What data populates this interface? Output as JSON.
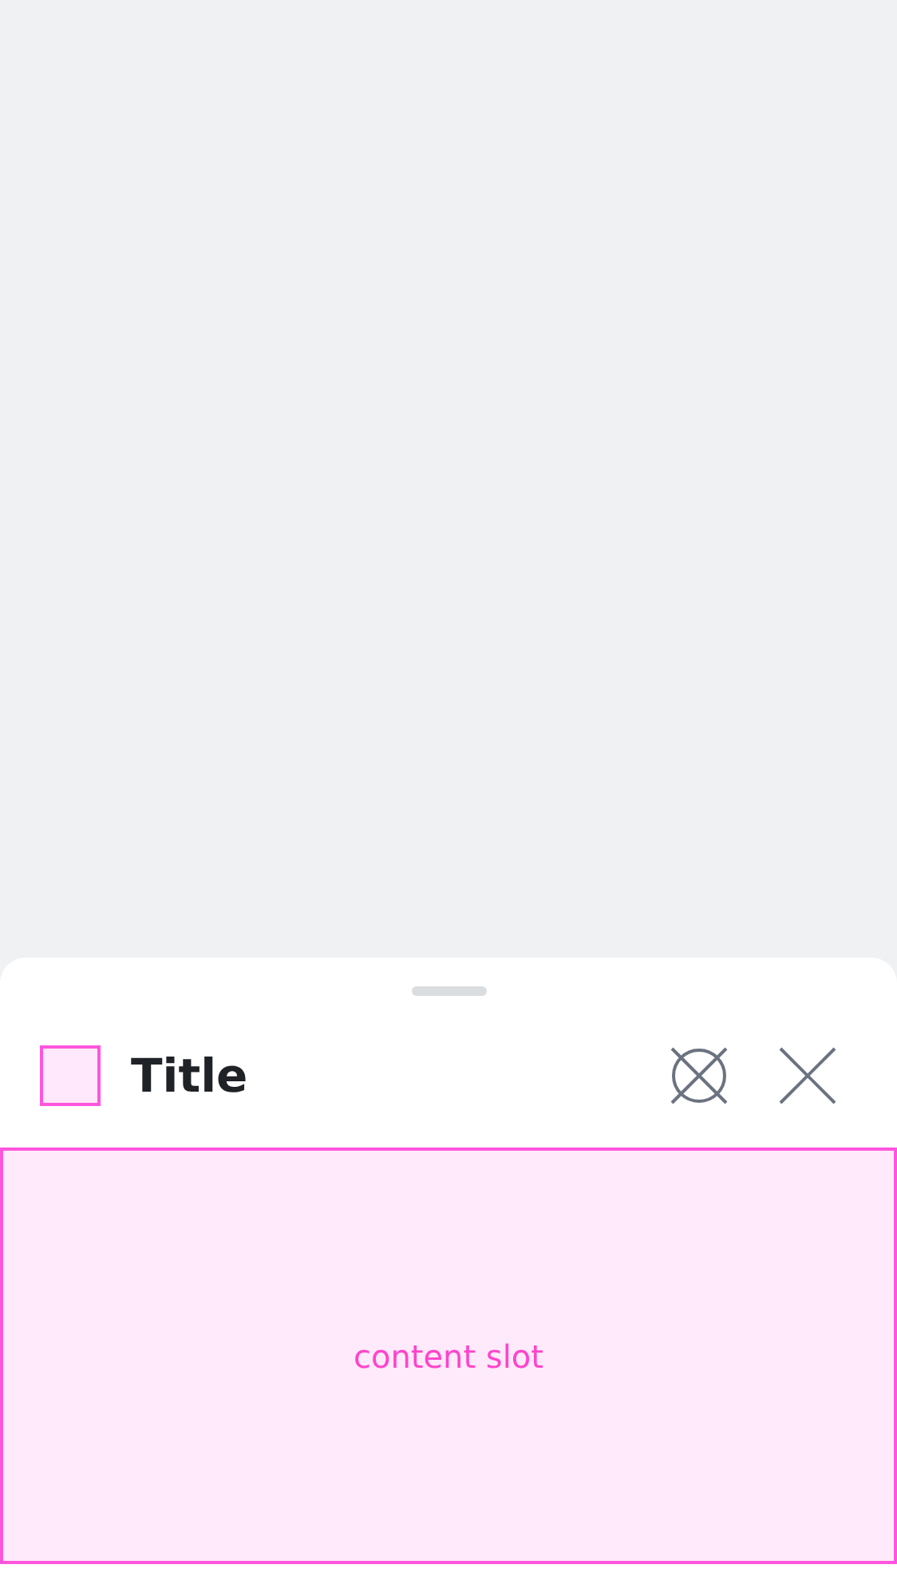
{
  "sheet": {
    "title": "Title",
    "content_slot": {
      "label": "content slot"
    }
  }
}
